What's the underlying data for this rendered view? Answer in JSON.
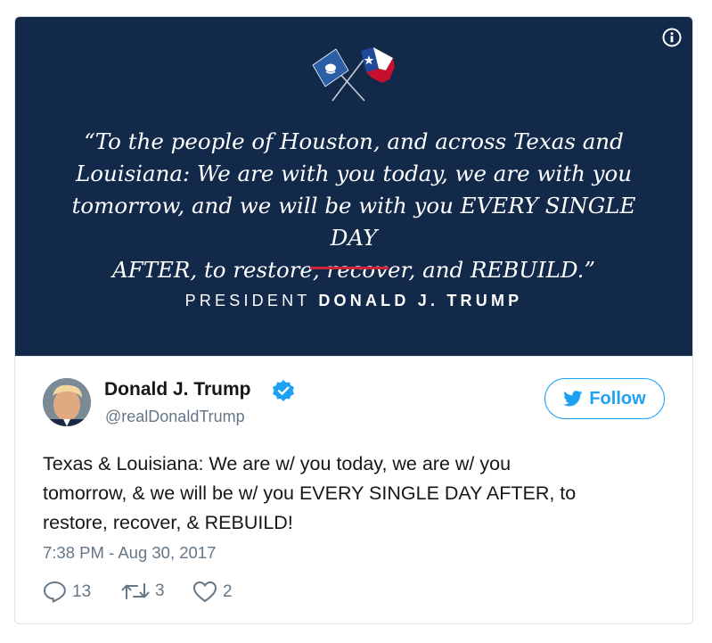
{
  "banner": {
    "quote_lines": [
      "“To the people of Houston, and across Texas and",
      "Louisiana: We are with you today, we are with you",
      "tomorrow, and we will be with you EVERY SINGLE DAY",
      "AFTER, to restore, recover, and REBUILD.”"
    ],
    "attribution_prefix": "PRESIDENT",
    "attribution_name": "DONALD J. TRUMP",
    "colors": {
      "background": "#12294a",
      "accent_rule": "#d0243a"
    },
    "icons": {
      "info": "info-icon",
      "flags": "crossed-flags-louisiana-texas"
    }
  },
  "tweet": {
    "author_name": "Donald J. Trump",
    "handle": "@realDonaldTrump",
    "verified": true,
    "follow_label": "Follow",
    "text_lines": [
      "Texas & Louisiana: We are w/ you today, we are w/ you",
      "tomorrow, & we will be w/ you EVERY SINGLE DAY AFTER, to",
      "restore, recover, & REBUILD!"
    ],
    "timestamp": "7:38 PM - Aug 30, 2017",
    "actions": {
      "replies": "13",
      "retweets": "3",
      "likes": "2"
    },
    "colors": {
      "accent": "#1da1f2",
      "muted": "#657786",
      "text": "#14171a"
    }
  }
}
